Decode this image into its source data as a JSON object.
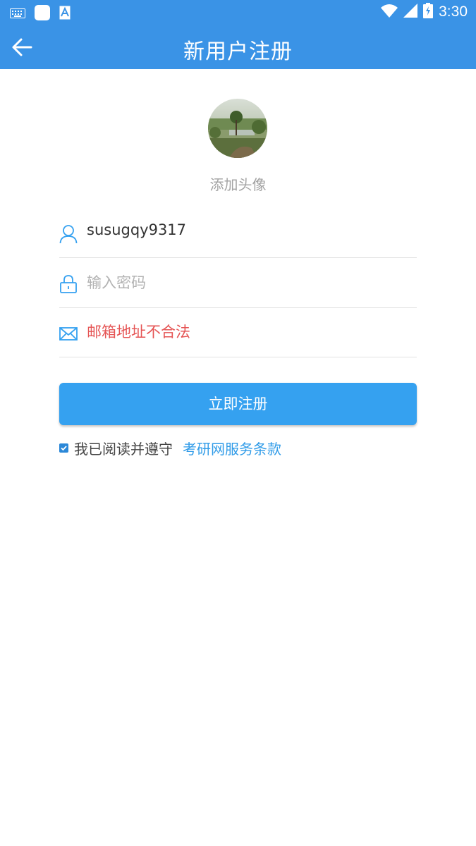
{
  "status_bar": {
    "time": "3:30"
  },
  "header": {
    "title": "新用户注册"
  },
  "avatar": {
    "label": "添加头像"
  },
  "form": {
    "username_value": "susugqy9317",
    "password_placeholder": "输入密码",
    "email_error": "邮箱地址不合法"
  },
  "register_button": {
    "label": "立即注册"
  },
  "agreement": {
    "checked": true,
    "text": "我已阅读并遵守",
    "link_text": "考研网服务条款"
  },
  "colors": {
    "primary": "#3a93e6",
    "button": "#35a1f0",
    "error": "#e55454",
    "link": "#2f9be8"
  }
}
